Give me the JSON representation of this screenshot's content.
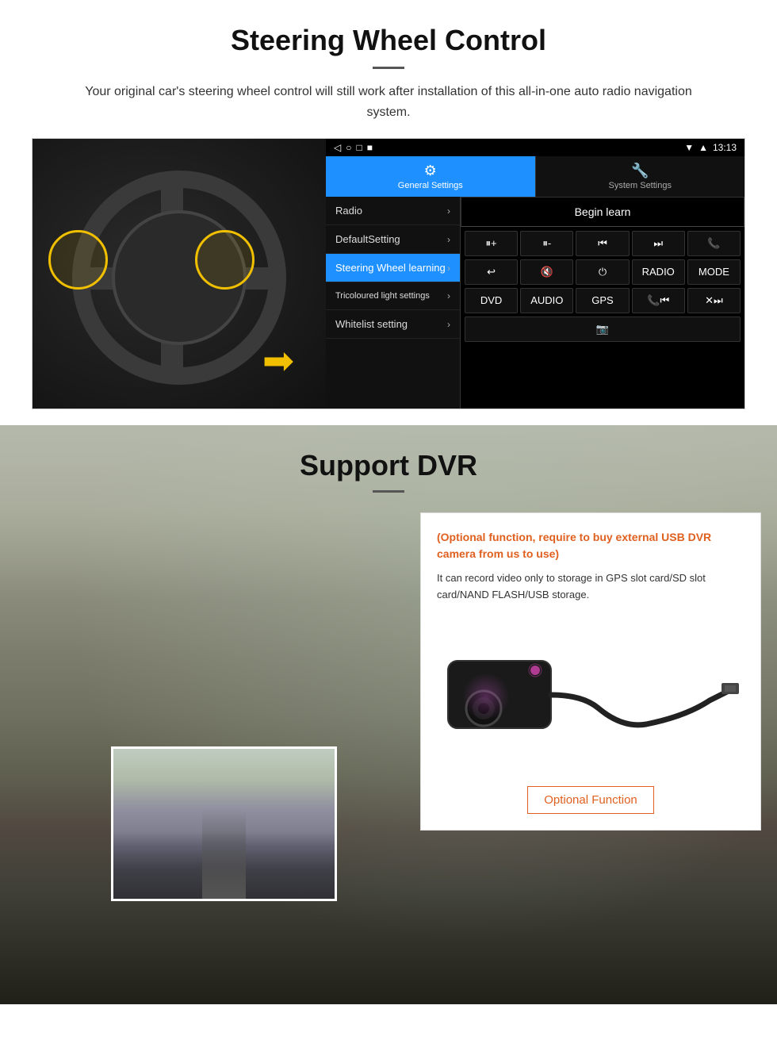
{
  "steering": {
    "title": "Steering Wheel Control",
    "description": "Your original car's steering wheel control will still work after installation of this all-in-one auto radio navigation system.",
    "statusbar": {
      "time": "13:13",
      "icons": [
        "◁",
        "○",
        "□",
        "■",
        "▼",
        "◀"
      ]
    },
    "tabs": {
      "general": "General Settings",
      "system": "System Settings"
    },
    "menu": {
      "items": [
        {
          "label": "Radio",
          "active": false
        },
        {
          "label": "DefaultSetting",
          "active": false
        },
        {
          "label": "Steering Wheel learning",
          "active": true
        },
        {
          "label": "Tricoloured light settings",
          "active": false
        },
        {
          "label": "Whitelist setting",
          "active": false
        }
      ]
    },
    "begin_learn": "Begin learn",
    "buttons": {
      "row1": [
        "🔊+",
        "🔊-",
        "⏮",
        "⏭",
        "📞"
      ],
      "row2": [
        "↩",
        "🔇×",
        "⏻",
        "RADIO",
        "MODE"
      ],
      "row3": [
        "DVD",
        "AUDIO",
        "GPS",
        "📞⏮",
        "×⏭"
      ],
      "row4": [
        "📷"
      ]
    }
  },
  "dvr": {
    "title": "Support DVR",
    "optional_text": "(Optional function, require to buy external USB DVR camera from us to use)",
    "description": "It can record video only to storage in GPS slot card/SD slot card/NAND FLASH/USB storage.",
    "optional_btn_label": "Optional Function"
  }
}
